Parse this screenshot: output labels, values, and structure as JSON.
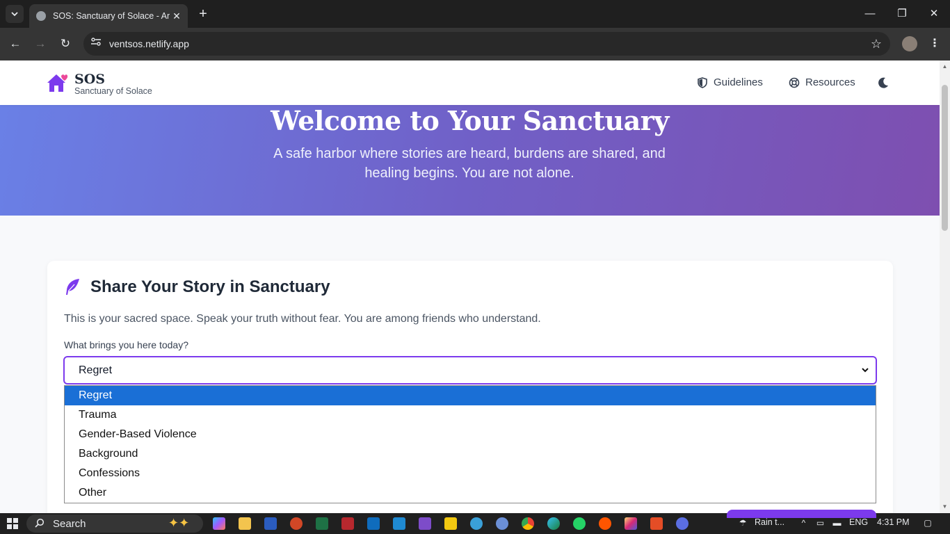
{
  "browser": {
    "tab_title": "SOS: Sanctuary of Solace - Anonymous",
    "url": "ventsos.netlify.app",
    "new_tab_glyph": "+",
    "close_glyph": "✕",
    "minimize_glyph": "—",
    "restore_glyph": "❐",
    "window_close_glyph": "✕",
    "back_glyph": "←",
    "forward_glyph": "→",
    "reload_glyph": "↻",
    "star_glyph": "☆",
    "menu_glyph": "⋮"
  },
  "site": {
    "brand_name": "SOS",
    "brand_subtitle": "Sanctuary of Solace",
    "nav": {
      "guidelines": "Guidelines",
      "resources": "Resources"
    },
    "icons": {
      "logo": "house-heart-icon",
      "guidelines": "shield-icon",
      "resources": "life-ring-icon",
      "theme": "moon-icon",
      "card": "feather-icon"
    }
  },
  "hero": {
    "title": "Welcome to Your Sanctuary",
    "subtitle": "A safe harbor where stories are heard, burdens are shared, and healing begins. You are not alone."
  },
  "story_form": {
    "title": "Share Your Story in Sanctuary",
    "description": "This is your sacred space. Speak your truth without fear. You are among friends who understand.",
    "category_label": "What brings you here today?",
    "selected_category": "Regret",
    "options": [
      "Regret",
      "Trauma",
      "Gender-Based Violence",
      "Background",
      "Confessions",
      "Other"
    ]
  },
  "taskbar": {
    "search_placeholder": "Search",
    "weather": "Rain t...",
    "language": "ENG",
    "time": "4:31 PM"
  },
  "colors": {
    "accent": "#7c3aed",
    "hero_start": "#6a80e6",
    "hero_end": "#7e4fb0",
    "selection": "#1a6fd6"
  }
}
